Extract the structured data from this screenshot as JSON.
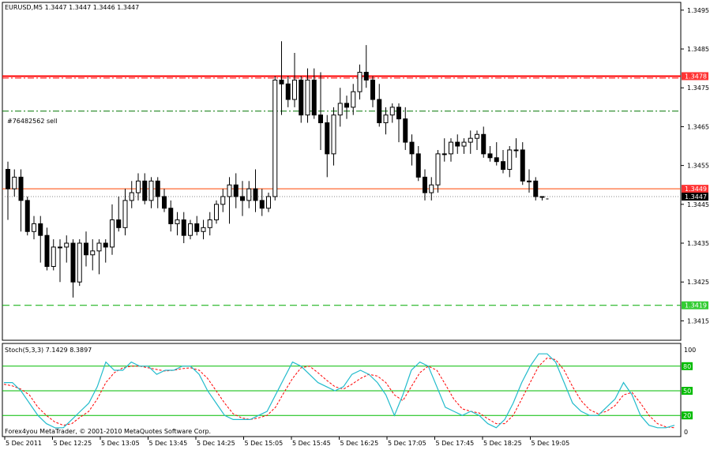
{
  "chart_data": {
    "type": "candlestick",
    "symbol_header": "EURUSD,M5  1.3447 1.3447 1.3446 1.3447",
    "price_range": [
      1.341,
      1.3497
    ],
    "price_ticks": [
      "1.3495",
      "1.3485",
      "1.3475",
      "1.3465",
      "1.3455",
      "1.3445",
      "1.3435",
      "1.3425",
      "1.3415"
    ],
    "time_labels": [
      "5 Dec 2011",
      "5 Dec 12:25",
      "5 Dec 13:05",
      "5 Dec 13:45",
      "5 Dec 14:25",
      "5 Dec 15:05",
      "5 Dec 15:45",
      "5 Dec 16:25",
      "5 Dec 17:05",
      "5 Dec 17:45",
      "5 Dec 18:25",
      "5 Dec 19:05"
    ],
    "candles": [
      [
        1.3454,
        1.3456,
        1.3441,
        1.3449
      ],
      [
        1.3449,
        1.3454,
        1.3447,
        1.3452
      ],
      [
        1.3452,
        1.3454,
        1.3438,
        1.3446
      ],
      [
        1.3446,
        1.3447,
        1.3437,
        1.3438
      ],
      [
        1.3438,
        1.3442,
        1.3436,
        1.344
      ],
      [
        1.344,
        1.3442,
        1.343,
        1.3437
      ],
      [
        1.3437,
        1.3439,
        1.3428,
        1.3429
      ],
      [
        1.3429,
        1.3436,
        1.3428,
        1.3434
      ],
      [
        1.3434,
        1.3436,
        1.3425,
        1.3434
      ],
      [
        1.3434,
        1.3437,
        1.343,
        1.3435
      ],
      [
        1.3435,
        1.3436,
        1.3421,
        1.3425
      ],
      [
        1.3425,
        1.3436,
        1.3424,
        1.3435
      ],
      [
        1.3435,
        1.3438,
        1.3429,
        1.3432
      ],
      [
        1.3432,
        1.3436,
        1.3428,
        1.3433
      ],
      [
        1.3433,
        1.3436,
        1.3427,
        1.3435
      ],
      [
        1.3435,
        1.3436,
        1.343,
        1.3434
      ],
      [
        1.3434,
        1.3445,
        1.3432,
        1.3441
      ],
      [
        1.3441,
        1.3447,
        1.3438,
        1.3439
      ],
      [
        1.3439,
        1.3449,
        1.3437,
        1.3446
      ],
      [
        1.3446,
        1.3451,
        1.3444,
        1.3448
      ],
      [
        1.3448,
        1.3453,
        1.3446,
        1.3451
      ],
      [
        1.3451,
        1.3453,
        1.3445,
        1.3446
      ],
      [
        1.3446,
        1.3452,
        1.3444,
        1.3451
      ],
      [
        1.3451,
        1.3452,
        1.3444,
        1.3447
      ],
      [
        1.3447,
        1.3449,
        1.3443,
        1.3444
      ],
      [
        1.3444,
        1.3446,
        1.3438,
        1.344
      ],
      [
        1.344,
        1.3443,
        1.3437,
        1.3441
      ],
      [
        1.3441,
        1.3443,
        1.3435,
        1.3437
      ],
      [
        1.3437,
        1.3441,
        1.3436,
        1.344
      ],
      [
        1.344,
        1.3442,
        1.3437,
        1.3438
      ],
      [
        1.3438,
        1.3441,
        1.3436,
        1.3439
      ],
      [
        1.3439,
        1.3443,
        1.3437,
        1.3441
      ],
      [
        1.3441,
        1.3446,
        1.344,
        1.3445
      ],
      [
        1.3445,
        1.3449,
        1.3443,
        1.3447
      ],
      [
        1.3447,
        1.3452,
        1.344,
        1.345
      ],
      [
        1.345,
        1.3453,
        1.3444,
        1.3447
      ],
      [
        1.3447,
        1.3451,
        1.3442,
        1.3446
      ],
      [
        1.3446,
        1.3451,
        1.3444,
        1.3449
      ],
      [
        1.3449,
        1.3454,
        1.3443,
        1.3446
      ],
      [
        1.3446,
        1.3449,
        1.3442,
        1.3444
      ],
      [
        1.3444,
        1.3448,
        1.3443,
        1.3447
      ],
      [
        1.3447,
        1.3478,
        1.3446,
        1.3477
      ],
      [
        1.3477,
        1.3487,
        1.3468,
        1.3476
      ],
      [
        1.3476,
        1.3478,
        1.347,
        1.3472
      ],
      [
        1.3472,
        1.3484,
        1.347,
        1.3477
      ],
      [
        1.3477,
        1.3478,
        1.3466,
        1.3468
      ],
      [
        1.3468,
        1.348,
        1.3466,
        1.3477
      ],
      [
        1.3477,
        1.348,
        1.3467,
        1.3468
      ],
      [
        1.3468,
        1.3479,
        1.3459,
        1.3466
      ],
      [
        1.3466,
        1.3468,
        1.3452,
        1.3458
      ],
      [
        1.3458,
        1.347,
        1.3455,
        1.3468
      ],
      [
        1.3468,
        1.3475,
        1.3465,
        1.3471
      ],
      [
        1.3471,
        1.3473,
        1.3467,
        1.347
      ],
      [
        1.347,
        1.3476,
        1.3468,
        1.3474
      ],
      [
        1.3474,
        1.3481,
        1.3472,
        1.3479
      ],
      [
        1.3479,
        1.3486,
        1.3475,
        1.3477
      ],
      [
        1.3477,
        1.3478,
        1.347,
        1.3472
      ],
      [
        1.3472,
        1.3476,
        1.3465,
        1.3466
      ],
      [
        1.3466,
        1.347,
        1.3463,
        1.3468
      ],
      [
        1.3468,
        1.3471,
        1.3466,
        1.347
      ],
      [
        1.347,
        1.3471,
        1.3461,
        1.3467
      ],
      [
        1.3467,
        1.347,
        1.3459,
        1.3461
      ],
      [
        1.3461,
        1.3463,
        1.3455,
        1.3458
      ],
      [
        1.3458,
        1.346,
        1.3451,
        1.3452
      ],
      [
        1.3452,
        1.3454,
        1.3446,
        1.3448
      ],
      [
        1.3448,
        1.3452,
        1.3446,
        1.345
      ],
      [
        1.345,
        1.3459,
        1.3448,
        1.3458
      ],
      [
        1.3458,
        1.3462,
        1.3456,
        1.3458
      ],
      [
        1.3458,
        1.3462,
        1.3456,
        1.3461
      ],
      [
        1.3461,
        1.3463,
        1.3458,
        1.346
      ],
      [
        1.346,
        1.3462,
        1.3458,
        1.3461
      ],
      [
        1.3461,
        1.3464,
        1.3458,
        1.3462
      ],
      [
        1.3462,
        1.3464,
        1.3459,
        1.3463
      ],
      [
        1.3463,
        1.3465,
        1.3457,
        1.3458
      ],
      [
        1.3458,
        1.346,
        1.3456,
        1.3457
      ],
      [
        1.3457,
        1.3461,
        1.3455,
        1.3456
      ],
      [
        1.3456,
        1.3459,
        1.3453,
        1.3454
      ],
      [
        1.3454,
        1.346,
        1.3452,
        1.3459
      ],
      [
        1.3459,
        1.3462,
        1.3457,
        1.3459
      ],
      [
        1.3459,
        1.3461,
        1.345,
        1.3451
      ],
      [
        1.3451,
        1.3454,
        1.3448,
        1.3451
      ],
      [
        1.3451,
        1.3452,
        1.3446,
        1.3447
      ],
      [
        1.3447,
        1.3447,
        1.3446,
        1.3447
      ]
    ],
    "horizontal_lines": [
      {
        "price": 1.3478,
        "color": "#ff0000",
        "style": "solid",
        "width": 2
      },
      {
        "price": 1.34775,
        "color": "#ff0000",
        "style": "dashdot",
        "width": 1
      },
      {
        "price": 1.3469,
        "color": "#007700",
        "style": "dashdot",
        "width": 1
      },
      {
        "price": 1.3449,
        "color": "#ff4400",
        "style": "solid",
        "width": 1
      },
      {
        "price": 1.3419,
        "color": "#00aa00",
        "style": "dashed",
        "width": 1
      }
    ],
    "order_label": "#76482562 sell",
    "price_badges": [
      {
        "text": "1.3478",
        "price": 1.3478,
        "bg": "#ff3333",
        "fg": "#ffffff"
      },
      {
        "text": "1.3449",
        "price": 1.3449,
        "bg": "#ff3333",
        "fg": "#ffffff"
      },
      {
        "text": "1.3447",
        "price": 1.3447,
        "bg": "#000000",
        "fg": "#ffffff"
      },
      {
        "text": "1.3419",
        "price": 1.3419,
        "bg": "#33cc33",
        "fg": "#ffffff"
      }
    ],
    "stoch": {
      "header": "Stoch(5,3,3) 7.1429 8.3897",
      "levels": [
        "100",
        "80",
        "50",
        "20",
        "0"
      ],
      "level_lines": [
        80,
        50,
        20
      ],
      "main": [
        60,
        60,
        50,
        35,
        20,
        10,
        5,
        5,
        15,
        25,
        35,
        55,
        85,
        75,
        75,
        85,
        80,
        80,
        70,
        75,
        75,
        80,
        80,
        70,
        50,
        35,
        20,
        15,
        15,
        15,
        20,
        25,
        45,
        65,
        85,
        80,
        70,
        60,
        55,
        50,
        55,
        70,
        75,
        70,
        60,
        45,
        20,
        45,
        75,
        85,
        80,
        55,
        30,
        25,
        20,
        25,
        20,
        10,
        5,
        15,
        35,
        60,
        80,
        95,
        95,
        85,
        60,
        35,
        25,
        20,
        20,
        30,
        40,
        60,
        45,
        20,
        8,
        5,
        5,
        8
      ],
      "signal": [
        58,
        56,
        52,
        45,
        30,
        20,
        12,
        8,
        10,
        18,
        25,
        40,
        60,
        72,
        78,
        80,
        80,
        78,
        76,
        74,
        75,
        77,
        78,
        75,
        65,
        50,
        35,
        22,
        17,
        15,
        17,
        20,
        30,
        48,
        65,
        78,
        80,
        72,
        63,
        55,
        52,
        58,
        65,
        70,
        68,
        60,
        45,
        38,
        55,
        72,
        80,
        75,
        58,
        40,
        28,
        25,
        23,
        16,
        10,
        10,
        20,
        40,
        60,
        80,
        90,
        88,
        75,
        55,
        38,
        27,
        22,
        25,
        32,
        45,
        48,
        35,
        20,
        10,
        6,
        5
      ]
    },
    "footer": "Forex4you MetaTrader, © 2001-2010 MetaQuotes Software Corp."
  }
}
